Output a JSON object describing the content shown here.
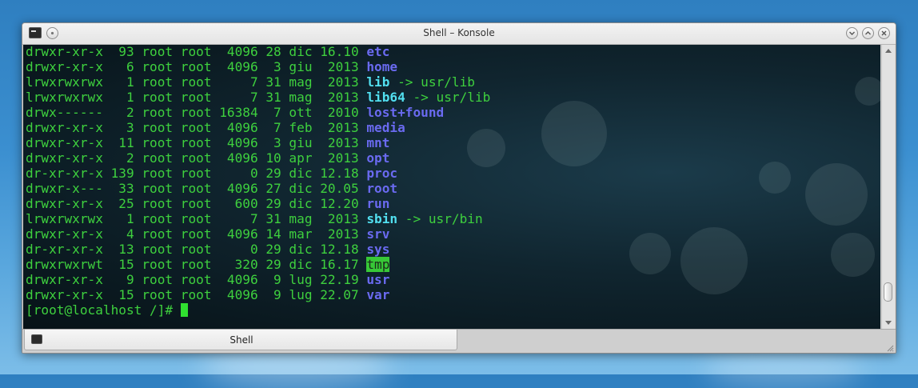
{
  "window": {
    "title": "Shell – Konsole"
  },
  "tabs": [
    {
      "label": "Shell"
    }
  ],
  "terminal": {
    "lines": [
      [
        {
          "t": "drwxr-xr-x  93 root root  4096 28 dic 16.10 "
        },
        {
          "t": "etc",
          "c": "d"
        }
      ],
      [
        {
          "t": "drwxr-xr-x   6 root root  4096  3 giu  2013 "
        },
        {
          "t": "home",
          "c": "d"
        }
      ],
      [
        {
          "t": "lrwxrwxrwx   1 root root     7 31 mag  2013 "
        },
        {
          "t": "lib",
          "c": "l"
        },
        {
          "t": " -> usr/lib"
        }
      ],
      [
        {
          "t": "lrwxrwxrwx   1 root root     7 31 mag  2013 "
        },
        {
          "t": "lib64",
          "c": "l"
        },
        {
          "t": " -> usr/lib"
        }
      ],
      [
        {
          "t": "drwx------   2 root root 16384  7 ott  2010 "
        },
        {
          "t": "lost+found",
          "c": "d"
        }
      ],
      [
        {
          "t": "drwxr-xr-x   3 root root  4096  7 feb  2013 "
        },
        {
          "t": "media",
          "c": "d"
        }
      ],
      [
        {
          "t": "drwxr-xr-x  11 root root  4096  3 giu  2013 "
        },
        {
          "t": "mnt",
          "c": "d"
        }
      ],
      [
        {
          "t": "drwxr-xr-x   2 root root  4096 10 apr  2013 "
        },
        {
          "t": "opt",
          "c": "d"
        }
      ],
      [
        {
          "t": "dr-xr-xr-x 139 root root     0 29 dic 12.18 "
        },
        {
          "t": "proc",
          "c": "d"
        }
      ],
      [
        {
          "t": "drwxr-x---  33 root root  4096 27 dic 20.05 "
        },
        {
          "t": "root",
          "c": "d"
        }
      ],
      [
        {
          "t": "drwxr-xr-x  25 root root   600 29 dic 12.20 "
        },
        {
          "t": "run",
          "c": "d"
        }
      ],
      [
        {
          "t": "lrwxrwxrwx   1 root root     7 31 mag  2013 "
        },
        {
          "t": "sbin",
          "c": "l"
        },
        {
          "t": " -> usr/bin"
        }
      ],
      [
        {
          "t": "drwxr-xr-x   4 root root  4096 14 mar  2013 "
        },
        {
          "t": "srv",
          "c": "d"
        }
      ],
      [
        {
          "t": "dr-xr-xr-x  13 root root     0 29 dic 12.18 "
        },
        {
          "t": "sys",
          "c": "d"
        }
      ],
      [
        {
          "t": "drwxrwxrwt  15 root root   320 29 dic 16.17 "
        },
        {
          "t": "tmp",
          "c": "t"
        }
      ],
      [
        {
          "t": "drwxr-xr-x   9 root root  4096  9 lug 22.19 "
        },
        {
          "t": "usr",
          "c": "d"
        }
      ],
      [
        {
          "t": "drwxr-xr-x  15 root root  4096  9 lug 22.07 "
        },
        {
          "t": "var",
          "c": "d"
        }
      ]
    ],
    "prompt": "[root@localhost /]# "
  },
  "colors": {
    "text": "#3ed03e",
    "directory": "#6a6af0",
    "symlink": "#52e0f0",
    "sticky_bg": "#37c837",
    "background": "#0e222b"
  },
  "icons": {
    "menu": "terminal-icon",
    "keep_above": "circle-icon",
    "minimize": "chevron-down-icon",
    "maximize": "chevron-up-icon",
    "close": "close-icon"
  }
}
